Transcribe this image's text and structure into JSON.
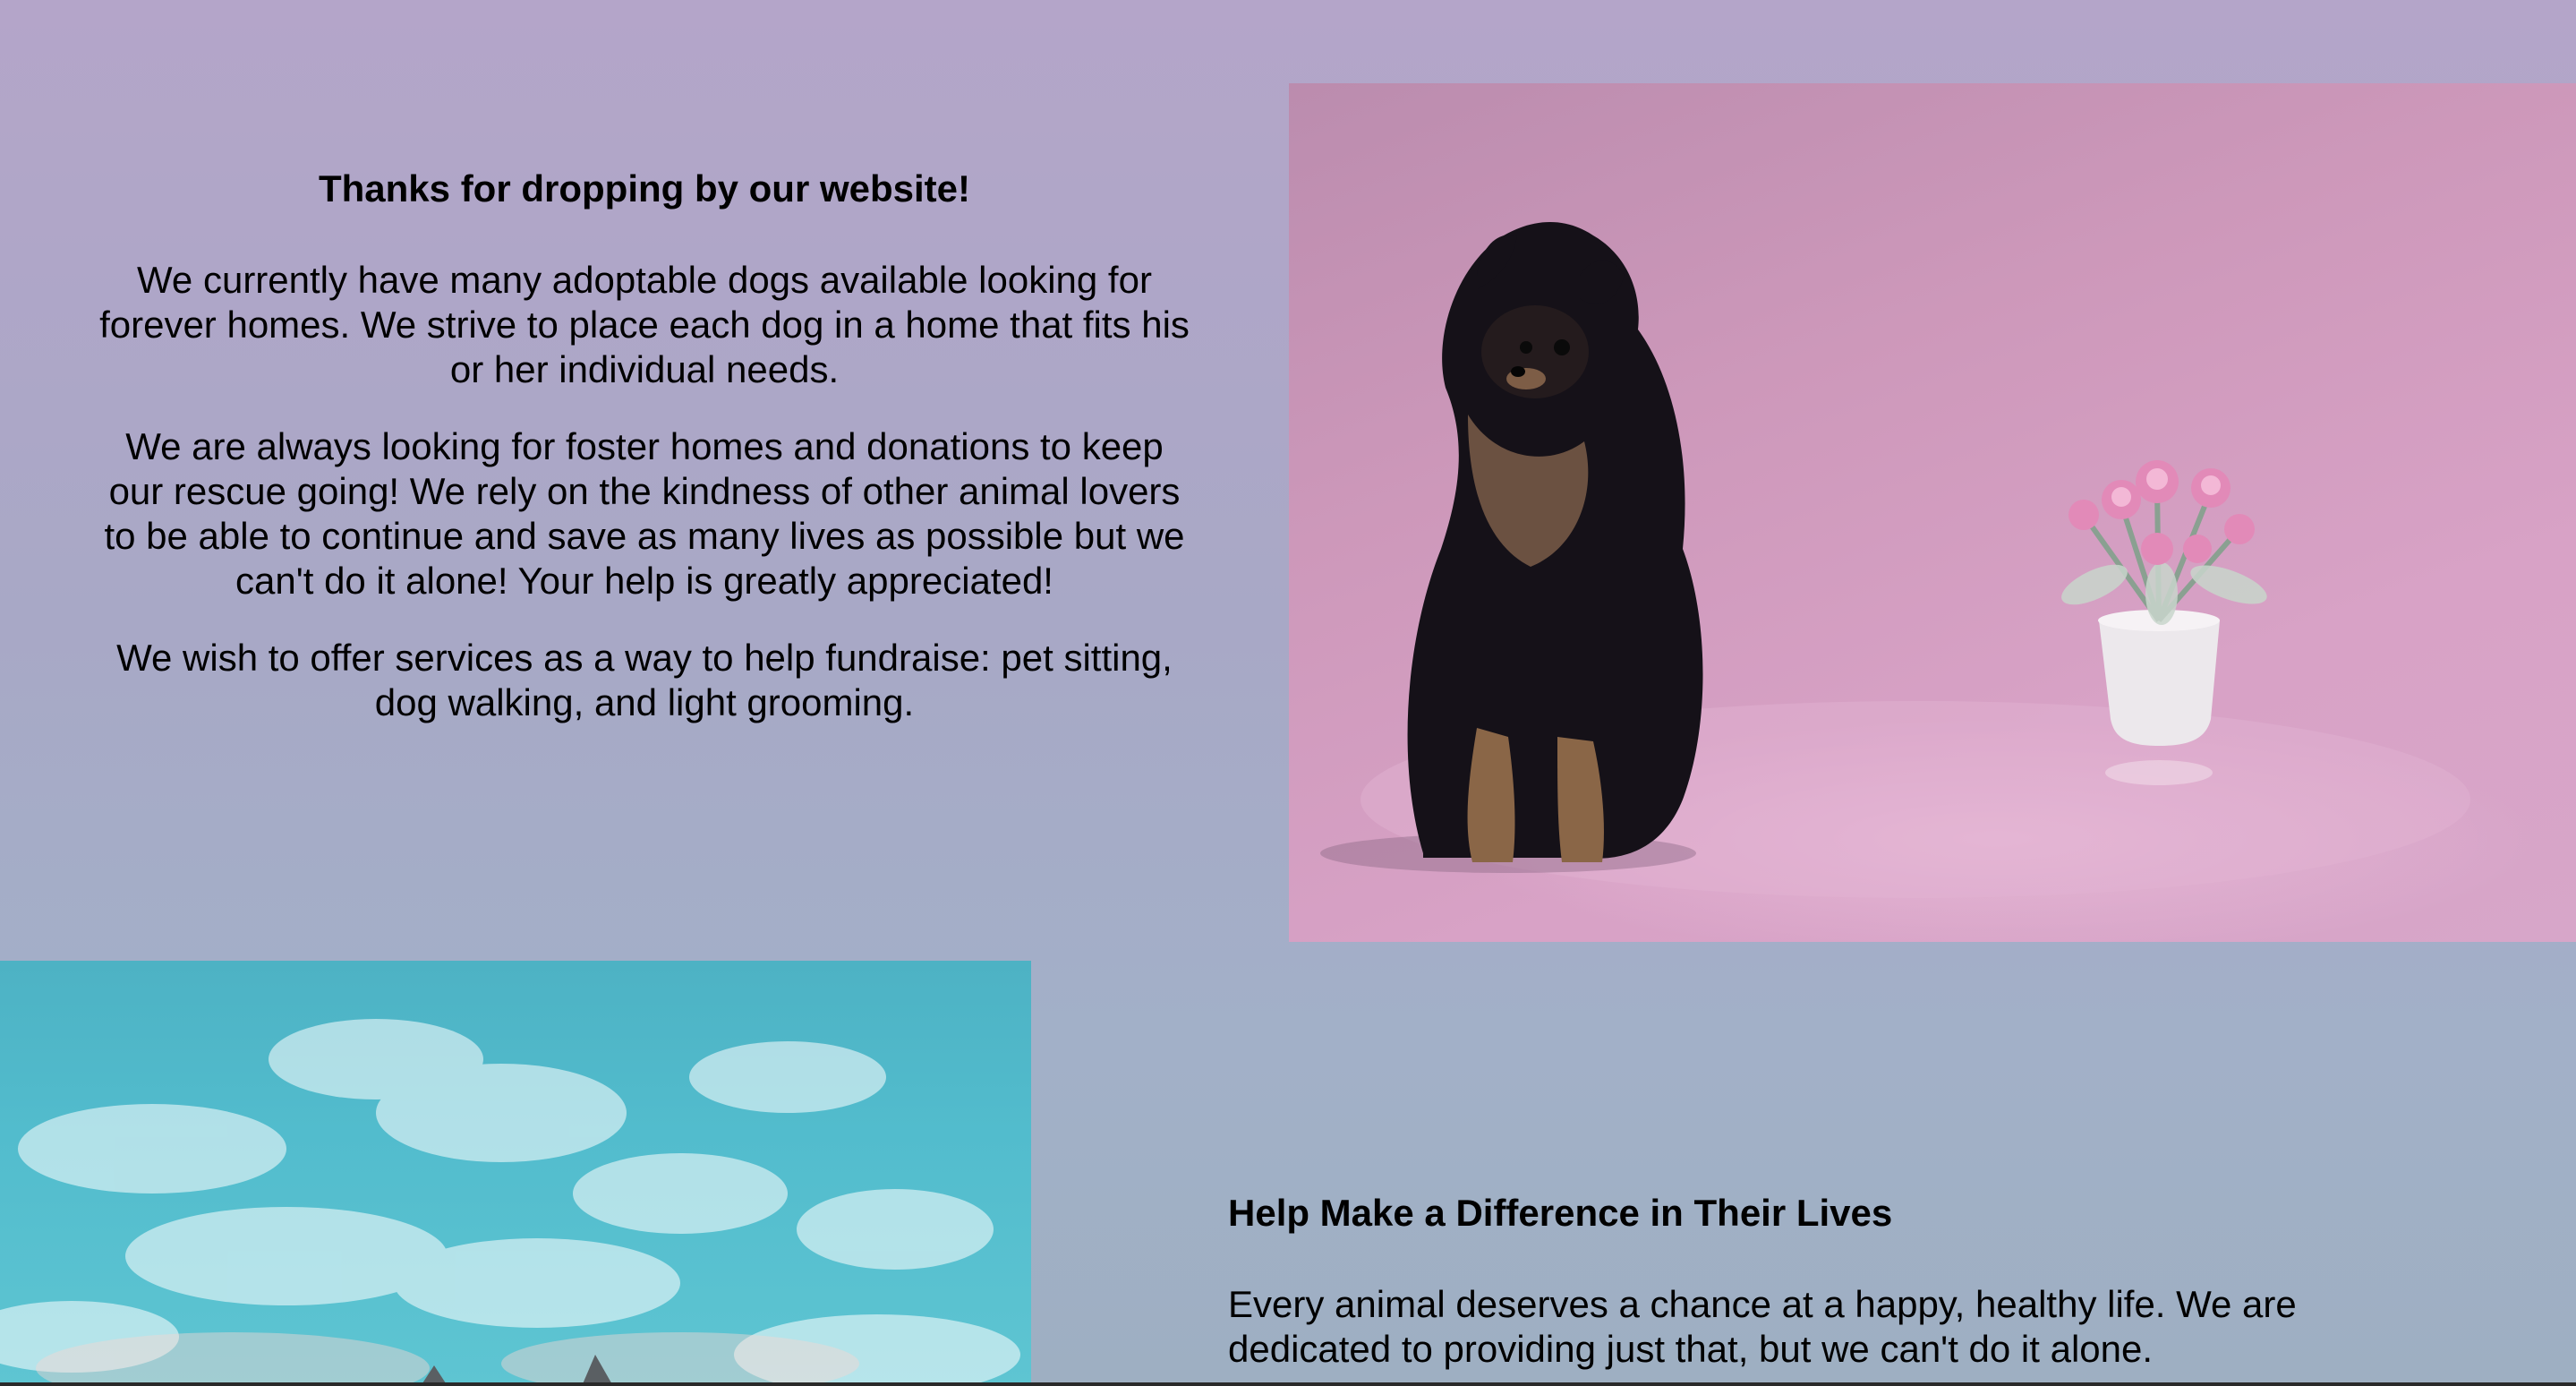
{
  "welcome": {
    "heading": "Thanks for dropping by our website!",
    "paragraphs": [
      "We currently have many adoptable dogs available looking for forever homes. We strive to place each dog in a home that fits his or her individual needs.",
      "We are always looking for foster homes and donations to keep our rescue going! We rely on the kindness of other animal lovers to be able to continue and save as many lives as possible but we can't do it alone! Your help is greatly appreciated!",
      "We wish to offer services as a way to help fundraise: pet sitting, dog walking, and light grooming."
    ]
  },
  "images": {
    "dog_photo": "pomeranian-dog-with-flowers-photo",
    "sky_photo": "sky-with-clouds-photo"
  },
  "difference": {
    "heading": "Help Make a Difference in Their Lives",
    "paragraph": "Every animal deserves a chance at a happy, healthy life. We are dedicated to providing just that, but we can't do it alone."
  },
  "colors": {
    "background_top": "#b4a5c9",
    "background_bottom": "#9eafc2",
    "dog_photo_bg": "#cd98ba",
    "sky": "#52bccd"
  }
}
